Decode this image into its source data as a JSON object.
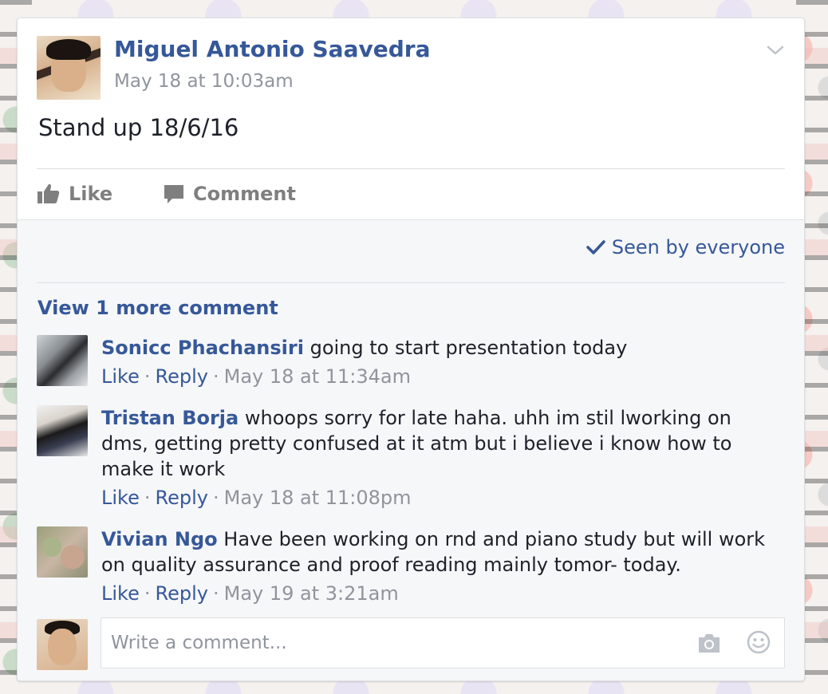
{
  "post": {
    "author": "Miguel Antonio Saavedra",
    "time": "May 18 at 10:03am",
    "body": "Stand up 18/6/16",
    "icons": {
      "menu": "chevron-down-icon"
    }
  },
  "actions": {
    "like_label": "Like",
    "comment_label": "Comment"
  },
  "seen": {
    "label": "Seen by everyone",
    "icon": "check-icon"
  },
  "view_more": "View 1 more comment",
  "comments": [
    {
      "author": "Sonicc Phachansiri",
      "text": "going to start presentation today",
      "like": "Like",
      "reply": "Reply",
      "time": "May 18 at 11:34am"
    },
    {
      "author": "Tristan Borja",
      "text": "whoops sorry for late haha. uhh im stil lworking on dms, getting pretty confused at it atm but i believe i know how to make it work",
      "like": "Like",
      "reply": "Reply",
      "time": "May 18 at 11:08pm"
    },
    {
      "author": "Vivian Ngo",
      "text": "Have been working on rnd and piano study but will work on quality assurance and proof reading mainly tomor- today.",
      "like": "Like",
      "reply": "Reply",
      "time": "May 19 at 3:21am"
    }
  ],
  "composer": {
    "placeholder": "Write a comment...",
    "icons": [
      "camera-icon",
      "emoji-icon"
    ]
  },
  "colors": {
    "link": "#365899",
    "muted": "#90949c",
    "text": "#1d2129",
    "comments_bg": "#f6f7f9"
  }
}
